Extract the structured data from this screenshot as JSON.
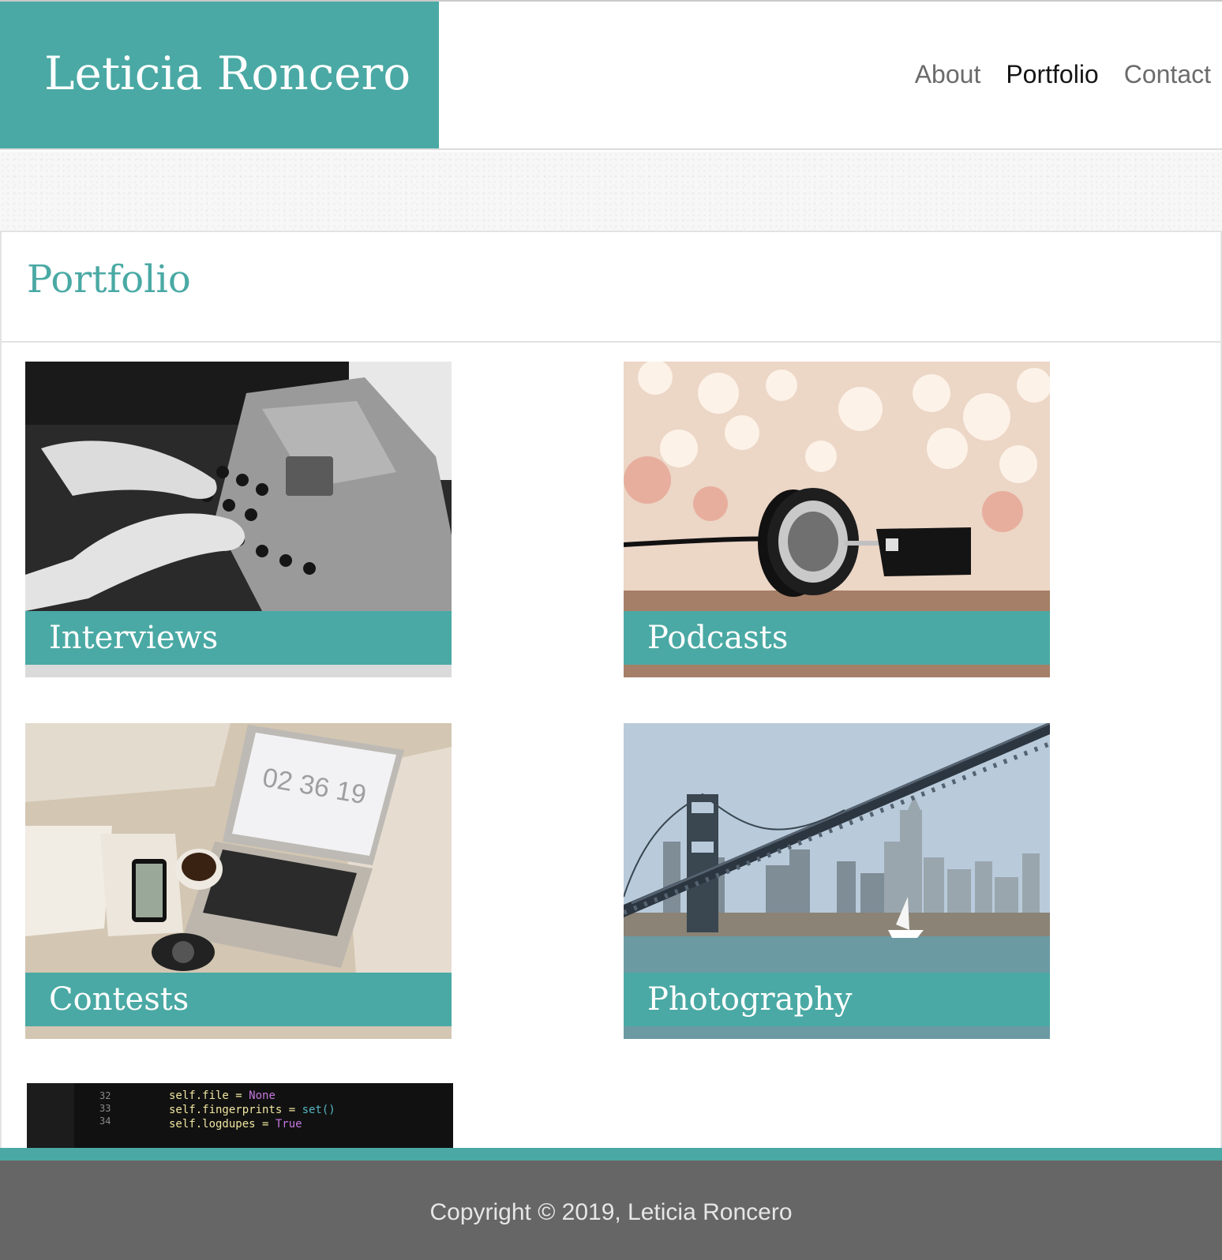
{
  "header": {
    "brand": "Leticia Roncero",
    "nav": [
      {
        "label": "About",
        "active": false
      },
      {
        "label": "Portfolio",
        "active": true
      },
      {
        "label": "Contact",
        "active": false
      }
    ]
  },
  "page": {
    "title": "Portfolio"
  },
  "portfolio": {
    "items": [
      {
        "label": "Interviews",
        "image": "typewriter-photo"
      },
      {
        "label": "Podcasts",
        "image": "headphones-photo"
      },
      {
        "label": "Contests",
        "image": "laptop-desk-photo"
      },
      {
        "label": "Photography",
        "image": "bridge-city-photo"
      }
    ],
    "partial_item_image": "code-screen-photo"
  },
  "footer": {
    "copyright": "Copyright © 2019, Leticia Roncero"
  },
  "colors": {
    "accent": "#4aa9a4",
    "footer_bg": "#666666",
    "nav_text": "#6b6b6b",
    "nav_active": "#151515"
  }
}
